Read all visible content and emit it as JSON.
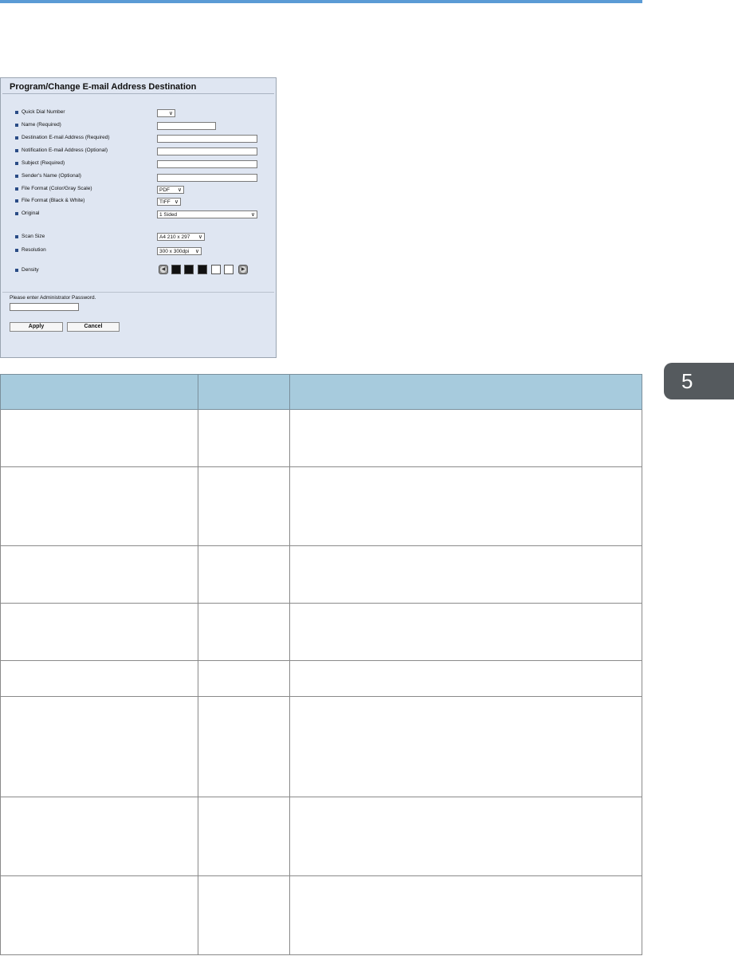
{
  "chapter_tab": {
    "number": "5"
  },
  "screenshot": {
    "title": "Program/Change E-mail Address Destination",
    "fields": [
      {
        "label": "Quick Dial Number"
      },
      {
        "label": "Name (Required)"
      },
      {
        "label": "Destination E-mail Address (Required)"
      },
      {
        "label": "Notification E-mail Address (Optional)"
      },
      {
        "label": "Subject (Required)"
      },
      {
        "label": "Sender's Name (Optional)"
      },
      {
        "label": "File Format (Color/Gray Scale)",
        "value": "PDF"
      },
      {
        "label": "File Format (Black & White)",
        "value": "TIFF"
      },
      {
        "label": "Original",
        "value": "1 Sided"
      },
      {
        "label": "Scan Size",
        "value": "A4 210 x 297"
      },
      {
        "label": "Resolution",
        "value": "300 x 300dpi"
      },
      {
        "label": "Density"
      }
    ],
    "password_prompt": "Please enter Administrator Password.",
    "apply_label": "Apply",
    "cancel_label": "Cancel",
    "icons": {
      "density_left": "left-arrow-icon",
      "density_right": "right-arrow-icon",
      "dropdown": "chevron-down-icon"
    }
  },
  "table": {
    "headers": [
      "",
      "",
      ""
    ],
    "rows": [
      [
        "",
        "",
        ""
      ],
      [
        "",
        "",
        ""
      ],
      [
        "",
        "",
        ""
      ],
      [
        "",
        "",
        ""
      ],
      [
        "",
        "",
        ""
      ],
      [
        "",
        "",
        ""
      ],
      [
        "",
        "",
        ""
      ],
      [
        "",
        "",
        ""
      ]
    ]
  },
  "colors": {
    "accent": "#5b9bd5",
    "table_header": "#a7cbdd",
    "panel_bg": "#dfe6f2",
    "chapter_tab": "#555a5e"
  }
}
